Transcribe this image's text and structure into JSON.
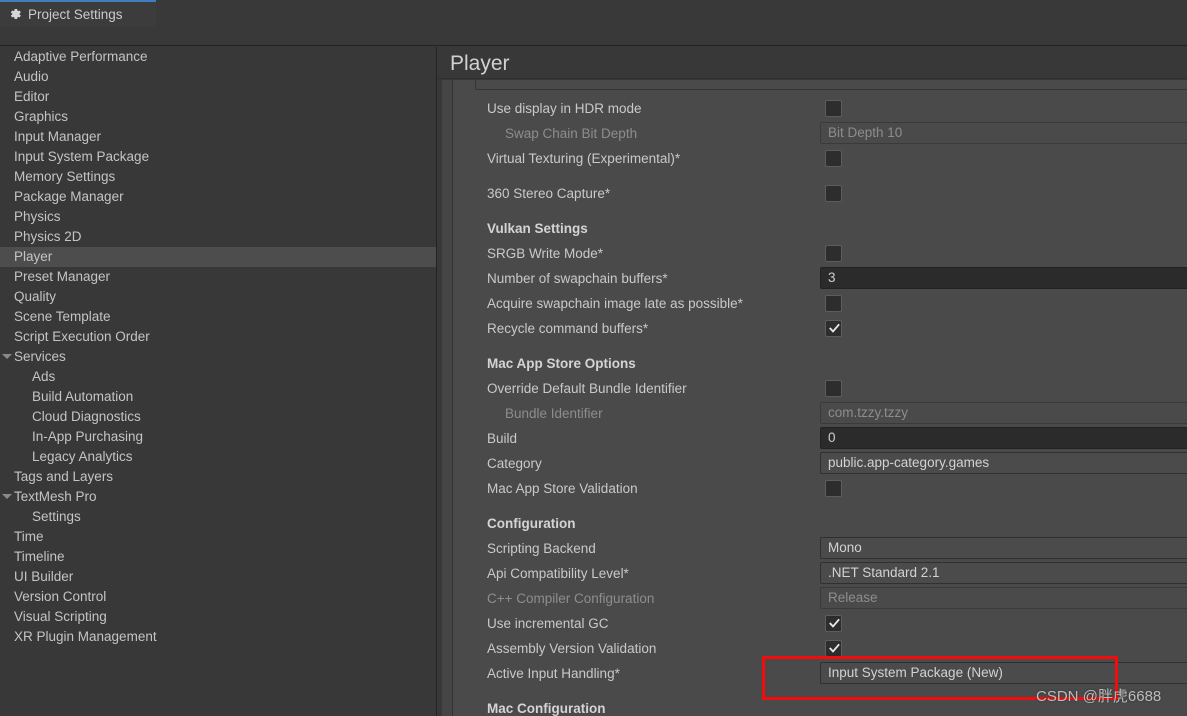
{
  "window": {
    "tab_label": "Project Settings",
    "tab_icon": "gear-icon",
    "accent_color": "#3e7ebf"
  },
  "sidebar": {
    "items": [
      {
        "label": "Adaptive Performance",
        "indent": 0,
        "selected": false,
        "expand": false
      },
      {
        "label": "Audio",
        "indent": 0,
        "selected": false,
        "expand": false
      },
      {
        "label": "Editor",
        "indent": 0,
        "selected": false,
        "expand": false
      },
      {
        "label": "Graphics",
        "indent": 0,
        "selected": false,
        "expand": false
      },
      {
        "label": "Input Manager",
        "indent": 0,
        "selected": false,
        "expand": false
      },
      {
        "label": "Input System Package",
        "indent": 0,
        "selected": false,
        "expand": false
      },
      {
        "label": "Memory Settings",
        "indent": 0,
        "selected": false,
        "expand": false
      },
      {
        "label": "Package Manager",
        "indent": 0,
        "selected": false,
        "expand": false
      },
      {
        "label": "Physics",
        "indent": 0,
        "selected": false,
        "expand": false
      },
      {
        "label": "Physics 2D",
        "indent": 0,
        "selected": false,
        "expand": false
      },
      {
        "label": "Player",
        "indent": 0,
        "selected": true,
        "expand": false
      },
      {
        "label": "Preset Manager",
        "indent": 0,
        "selected": false,
        "expand": false
      },
      {
        "label": "Quality",
        "indent": 0,
        "selected": false,
        "expand": false
      },
      {
        "label": "Scene Template",
        "indent": 0,
        "selected": false,
        "expand": false
      },
      {
        "label": "Script Execution Order",
        "indent": 0,
        "selected": false,
        "expand": false
      },
      {
        "label": "Services",
        "indent": 0,
        "selected": false,
        "expand": true
      },
      {
        "label": "Ads",
        "indent": 1,
        "selected": false,
        "expand": false
      },
      {
        "label": "Build Automation",
        "indent": 1,
        "selected": false,
        "expand": false
      },
      {
        "label": "Cloud Diagnostics",
        "indent": 1,
        "selected": false,
        "expand": false
      },
      {
        "label": "In-App Purchasing",
        "indent": 1,
        "selected": false,
        "expand": false
      },
      {
        "label": "Legacy Analytics",
        "indent": 1,
        "selected": false,
        "expand": false
      },
      {
        "label": "Tags and Layers",
        "indent": 0,
        "selected": false,
        "expand": false
      },
      {
        "label": "TextMesh Pro",
        "indent": 0,
        "selected": false,
        "expand": true
      },
      {
        "label": "Settings",
        "indent": 1,
        "selected": false,
        "expand": false
      },
      {
        "label": "Time",
        "indent": 0,
        "selected": false,
        "expand": false
      },
      {
        "label": "Timeline",
        "indent": 0,
        "selected": false,
        "expand": false
      },
      {
        "label": "UI Builder",
        "indent": 0,
        "selected": false,
        "expand": false
      },
      {
        "label": "Version Control",
        "indent": 0,
        "selected": false,
        "expand": false
      },
      {
        "label": "Visual Scripting",
        "indent": 0,
        "selected": false,
        "expand": false
      },
      {
        "label": "XR Plugin Management",
        "indent": 0,
        "selected": false,
        "expand": false
      }
    ]
  },
  "main": {
    "title": "Player",
    "rows": [
      {
        "kind": "checkbox",
        "label": "Use display in HDR mode",
        "indent": 1,
        "dim": false,
        "checked": false
      },
      {
        "kind": "field",
        "label": "Swap Chain Bit Depth",
        "indent": 2,
        "dim": true,
        "value": "Bit Depth 10",
        "style": "readonly"
      },
      {
        "kind": "checkbox",
        "label": "Virtual Texturing (Experimental)*",
        "indent": 1,
        "dim": false,
        "checked": false
      },
      {
        "kind": "spacer"
      },
      {
        "kind": "checkbox",
        "label": "360 Stereo Capture*",
        "indent": 1,
        "dim": false,
        "checked": false
      },
      {
        "kind": "spacer"
      },
      {
        "kind": "header",
        "label": "Vulkan Settings"
      },
      {
        "kind": "checkbox",
        "label": "SRGB Write Mode*",
        "indent": 1,
        "dim": false,
        "checked": false
      },
      {
        "kind": "field",
        "label": "Number of swapchain buffers*",
        "indent": 1,
        "dim": false,
        "value": "3",
        "style": "input"
      },
      {
        "kind": "checkbox",
        "label": "Acquire swapchain image late as possible*",
        "indent": 1,
        "dim": false,
        "checked": false
      },
      {
        "kind": "checkbox",
        "label": "Recycle command buffers*",
        "indent": 1,
        "dim": false,
        "checked": true
      },
      {
        "kind": "spacer"
      },
      {
        "kind": "header",
        "label": "Mac App Store Options"
      },
      {
        "kind": "checkbox",
        "label": "Override Default Bundle Identifier",
        "indent": 1,
        "dim": false,
        "checked": false
      },
      {
        "kind": "field",
        "label": "Bundle Identifier",
        "indent": 2,
        "dim": true,
        "value": "com.tzzy.tzzy",
        "style": "readonly"
      },
      {
        "kind": "field",
        "label": "Build",
        "indent": 1,
        "dim": false,
        "value": "0",
        "style": "input"
      },
      {
        "kind": "field",
        "label": "Category",
        "indent": 1,
        "dim": false,
        "value": "public.app-category.games",
        "style": "popup"
      },
      {
        "kind": "checkbox",
        "label": "Mac App Store Validation",
        "indent": 1,
        "dim": false,
        "checked": false
      },
      {
        "kind": "spacer"
      },
      {
        "kind": "header",
        "label": "Configuration"
      },
      {
        "kind": "field",
        "label": "Scripting Backend",
        "indent": 1,
        "dim": false,
        "value": "Mono",
        "style": "popup"
      },
      {
        "kind": "field",
        "label": "Api Compatibility Level*",
        "indent": 1,
        "dim": false,
        "value": ".NET Standard 2.1",
        "style": "popup"
      },
      {
        "kind": "field",
        "label": "C++ Compiler Configuration",
        "indent": 1,
        "dim": true,
        "value": "Release",
        "style": "readonly"
      },
      {
        "kind": "checkbox",
        "label": "Use incremental GC",
        "indent": 1,
        "dim": false,
        "checked": true
      },
      {
        "kind": "checkbox",
        "label": "Assembly Version Validation",
        "indent": 1,
        "dim": false,
        "checked": true
      },
      {
        "kind": "field",
        "label": "Active Input Handling*",
        "indent": 1,
        "dim": false,
        "value": "Input System Package (New)",
        "style": "popup"
      },
      {
        "kind": "spacer"
      },
      {
        "kind": "header",
        "label": "Mac Configuration"
      }
    ]
  },
  "annotation": {
    "highlight_color": "#f40c0c",
    "watermark": "CSDN @胖虎6688"
  }
}
